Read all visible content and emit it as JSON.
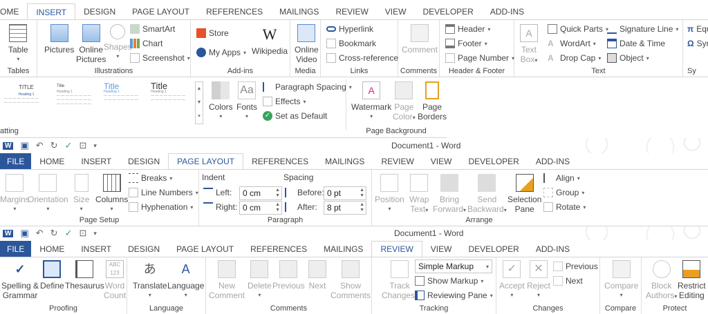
{
  "s1": {
    "tabs": [
      "OME",
      "INSERT",
      "DESIGN",
      "PAGE LAYOUT",
      "REFERENCES",
      "MAILINGS",
      "REVIEW",
      "VIEW",
      "DEVELOPER",
      "ADD-INS"
    ],
    "tables": {
      "table": "Table",
      "label": "Tables"
    },
    "illus": {
      "pictures": "Pictures",
      "online1": "Online",
      "online2": "Pictures",
      "shapes": "Shapes",
      "smartart": "SmartArt",
      "chart": "Chart",
      "screenshot": "Screenshot",
      "label": "Illustrations"
    },
    "addins": {
      "store": "Store",
      "myapps": "My Apps",
      "wiki": "Wikipedia",
      "label": "Add-ins"
    },
    "media": {
      "v1": "Online",
      "v2": "Video",
      "label": "Media"
    },
    "links": {
      "hyperlink": "Hyperlink",
      "bookmark": "Bookmark",
      "crossref": "Cross-reference",
      "label": "Links"
    },
    "comments": {
      "comment": "Comment",
      "label": "Comments"
    },
    "hf": {
      "header": "Header",
      "footer": "Footer",
      "pagenum": "Page Number",
      "label": "Header & Footer"
    },
    "text": {
      "tb1": "Text",
      "tb2": "Box",
      "quick": "Quick Parts",
      "wordart": "WordArt",
      "dropcap": "Drop Cap",
      "sig": "Signature Line",
      "date": "Date & Time",
      "object": "Object",
      "label": "Text"
    },
    "sym": {
      "eq": "Equ",
      "sym": "Sym",
      "label": "Sy"
    }
  },
  "s2": {
    "styles": [
      "TITLE",
      "Title",
      "Title",
      "Title"
    ],
    "heading": "Heading 1",
    "colors": "Colors",
    "fonts": "Fonts",
    "paraspacing": "Paragraph Spacing",
    "effects": "Effects",
    "setdefault": "Set as Default",
    "watermark": "Watermark",
    "pagecolor1": "Page",
    "pagecolor2": "Color",
    "borders1": "Page",
    "borders2": "Borders",
    "pglabel": "Page Background",
    "fmtlabel": "atting"
  },
  "s3": {
    "title": "Document1 - Word",
    "tabs": [
      "FILE",
      "HOME",
      "INSERT",
      "DESIGN",
      "PAGE LAYOUT",
      "REFERENCES",
      "MAILINGS",
      "REVIEW",
      "VIEW",
      "DEVELOPER",
      "ADD-INS"
    ],
    "margins": "Margins",
    "orientation": "Orientation",
    "size": "Size",
    "columns": "Columns",
    "breaks": "Breaks",
    "linenum": "Line Numbers",
    "hyphen": "Hyphenation",
    "pslabel": "Page Setup",
    "indent": "Indent",
    "spacing": "Spacing",
    "left": "Left:",
    "right": "Right:",
    "before": "Before:",
    "after": "After:",
    "leftv": "0 cm",
    "rightv": "0 cm",
    "beforev": "0 pt",
    "afterv": "8 pt",
    "paralabel": "Paragraph",
    "position": "Position",
    "wrap1": "Wrap",
    "wrap2": "Text",
    "bring1": "Bring",
    "bring2": "Forward",
    "send1": "Send",
    "send2": "Backward",
    "sel1": "Selection",
    "sel2": "Pane",
    "align": "Align",
    "group": "Group",
    "rotate": "Rotate",
    "arrlabel": "Arrange"
  },
  "s4": {
    "title": "Document1 - Word",
    "tabs": [
      "FILE",
      "HOME",
      "INSERT",
      "DESIGN",
      "PAGE LAYOUT",
      "REFERENCES",
      "MAILINGS",
      "REVIEW",
      "VIEW",
      "DEVELOPER",
      "ADD-INS"
    ],
    "spelling1": "Spelling &",
    "spelling2": "Grammar",
    "define": "Define",
    "thesaurus": "Thesaurus",
    "wc1": "Word",
    "wc2": "Count",
    "proofing": "Proofing",
    "translate": "Translate",
    "language": "Language",
    "langlabel": "Language",
    "new1": "New",
    "new2": "Comment",
    "delete": "Delete",
    "previous": "Previous",
    "next": "Next",
    "show1": "Show",
    "show2": "Comments",
    "comlabel": "Comments",
    "track1": "Track",
    "track2": "Changes",
    "simple": "Simple Markup",
    "showmarkup": "Show Markup",
    "revpane": "Reviewing Pane",
    "tracklabel": "Tracking",
    "accept": "Accept",
    "reject": "Reject",
    "prev": "Previous",
    "nxt": "Next",
    "chlabel": "Changes",
    "compare": "Compare",
    "cmplabel": "Compare",
    "block1": "Block",
    "block2": "Authors",
    "restrict1": "Restrict",
    "restrict2": "Editing",
    "protlabel": "Protect"
  }
}
